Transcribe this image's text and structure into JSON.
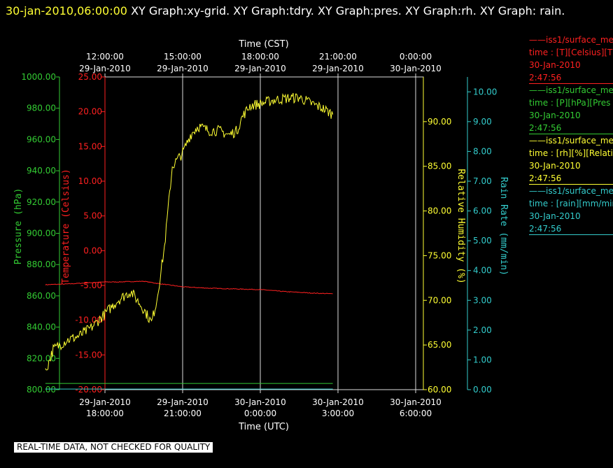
{
  "header": {
    "timestamp": "30-jan-2010,06:00:00",
    "title_rest": "XY Graph:xy-grid.  XY Graph:tdry.  XY Graph:pres.  XY Graph:rh.  XY Graph: rain."
  },
  "banner": "REAL-TIME DATA, NOT CHECKED FOR QUALITY",
  "legend": [
    {
      "name": "iss1/surface_me",
      "units": "time : [T][Celsius][T",
      "date": "30-Jan-2010",
      "time": "2:47:56",
      "color": "#ff2020"
    },
    {
      "name": "iss1/surface_me",
      "units": "time : [P][hPa][Pres",
      "date": "30-Jan-2010",
      "time": "2:47:56",
      "color": "#33cc33"
    },
    {
      "name": "iss1/surface_me",
      "units": "time : [rh][%][Relati",
      "date": "30-Jan-2010",
      "time": "2:47:56",
      "color": "#ffff33"
    },
    {
      "name": "iss1/surface_me",
      "units": "time : [rain][mm/min",
      "date": "30-Jan-2010",
      "time": "2:47:56",
      "color": "#33cccc"
    }
  ],
  "chart_data": {
    "type": "line",
    "x_bottom": {
      "label": "Time (UTC)",
      "ticks": [
        {
          "date": "29-Jan-2010",
          "time": "18:00:00"
        },
        {
          "date": "29-Jan-2010",
          "time": "21:00:00"
        },
        {
          "date": "30-Jan-2010",
          "time": "0:00:00"
        },
        {
          "date": "30-Jan-2010",
          "time": "3:00:00"
        },
        {
          "date": "30-Jan-2010",
          "time": "6:00:00"
        }
      ]
    },
    "x_top": {
      "label": "Time (CST)",
      "ticks": [
        {
          "time": "12:00:00",
          "date": "29-Jan-2010"
        },
        {
          "time": "15:00:00",
          "date": "29-Jan-2010"
        },
        {
          "time": "18:00:00",
          "date": "29-Jan-2010"
        },
        {
          "time": "21:00:00",
          "date": "29-Jan-2010"
        },
        {
          "time": "0:00:00",
          "date": "30-Jan-2010"
        }
      ]
    },
    "xlim_hours_utc_from_tick0": [
      0,
      12
    ],
    "axes": {
      "pressure": {
        "label": "Pressure (hPa)",
        "ylim": [
          800,
          1000
        ],
        "ticks": [
          "800.00",
          "820.00",
          "840.00",
          "860.00",
          "880.00",
          "900.00",
          "920.00",
          "940.00",
          "960.00",
          "980.00",
          "1000.00"
        ],
        "color": "#33cc33"
      },
      "temperature": {
        "label": "Temperature (Celsius)",
        "ylim": [
          -20,
          25
        ],
        "ticks": [
          "-20.00",
          "-15.00",
          "-10.00",
          "-5.00",
          "0.00",
          "5.00",
          "10.00",
          "15.00",
          "20.00",
          "25.00"
        ],
        "color": "#ff2020"
      },
      "rh": {
        "label": "Relative Humidity (%)",
        "ylim": [
          60,
          95
        ],
        "ticks": [
          "60.00",
          "65.00",
          "70.00",
          "75.00",
          "80.00",
          "85.00",
          "90.00"
        ],
        "color": "#ffff33"
      },
      "rain": {
        "label": "Rain Rate (mm/min)",
        "ylim": [
          0,
          10.5
        ],
        "ticks": [
          "0.00",
          "1.00",
          "2.00",
          "3.00",
          "4.00",
          "5.00",
          "6.00",
          "7.00",
          "8.00",
          "9.00",
          "10.00"
        ],
        "color": "#33cccc"
      }
    },
    "series": [
      {
        "axis": "temperature",
        "color": "#ff2020",
        "x": [
          -2.3,
          -1.5,
          -0.5,
          0,
          0.5,
          1.5,
          2.0,
          3.0,
          4.0,
          5.0,
          6.0,
          7.0,
          8.0,
          8.8
        ],
        "y": [
          -4.9,
          -4.8,
          -4.6,
          -4.5,
          -4.5,
          -4.4,
          -4.7,
          -5.2,
          -5.4,
          -5.5,
          -5.6,
          -5.9,
          -6.1,
          -6.2
        ],
        "noise": 0.05
      },
      {
        "axis": "pressure",
        "color": "#33cc33",
        "x": [
          -2.3,
          8.8
        ],
        "y": [
          804,
          804
        ],
        "noise": 0
      },
      {
        "axis": "rh",
        "color": "#ffff33",
        "x": [
          -2.3,
          -2.0,
          -1.5,
          -1.0,
          -0.5,
          0,
          0.5,
          1.0,
          1.5,
          1.8,
          2.0,
          2.3,
          2.6,
          3.0,
          3.3,
          3.6,
          4.0,
          4.4,
          4.8,
          5.1,
          5.3,
          5.6,
          6.0,
          6.5,
          7.0,
          7.5,
          8.0,
          8.4,
          8.8
        ],
        "y": [
          62.0,
          64.5,
          65.5,
          66.0,
          67.0,
          68.5,
          70.0,
          71.0,
          69.0,
          67.5,
          70.0,
          76.0,
          85.0,
          86.5,
          88.5,
          89.5,
          89.0,
          89.0,
          88.5,
          89.0,
          90.5,
          91.8,
          92.0,
          92.4,
          92.6,
          92.7,
          92.0,
          91.5,
          90.8
        ],
        "noise": 0.6
      },
      {
        "axis": "rain",
        "color": "#33cccc",
        "x": [
          -2.3,
          8.8
        ],
        "y": [
          0.02,
          0.02
        ],
        "noise": 0
      }
    ]
  }
}
